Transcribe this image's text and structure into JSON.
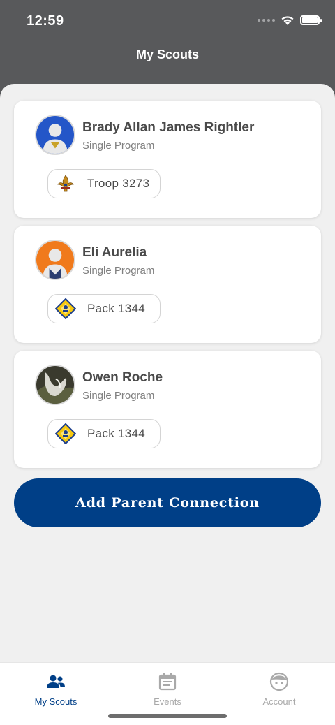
{
  "status_bar": {
    "time": "12:59"
  },
  "header": {
    "title": "My Scouts"
  },
  "scouts": [
    {
      "name": "Brady Allan James Rightler",
      "program": "Single Program",
      "unit": "Troop 3273",
      "unit_emblem": "scouts-bsa-fleur-de-lis-emblem",
      "avatar_color": "#2456c8"
    },
    {
      "name": "Eli  Aurelia",
      "program": "Single Program",
      "unit": "Pack 1344",
      "unit_emblem": "cub-scout-diamond-emblem",
      "avatar_color": "#f07a1c"
    },
    {
      "name": "Owen Roche",
      "program": "Single Program",
      "unit": "Pack 1344",
      "unit_emblem": "cub-scout-diamond-emblem",
      "avatar_color": "#3a3a2e"
    }
  ],
  "actions": {
    "add_parent_connection": "Add Parent Connection"
  },
  "tab_bar": {
    "tabs": [
      {
        "label": "My Scouts",
        "icon": "people-icon",
        "active": true
      },
      {
        "label": "Events",
        "icon": "calendar-icon",
        "active": false
      },
      {
        "label": "Account",
        "icon": "account-face-icon",
        "active": false
      }
    ]
  },
  "colors": {
    "primary": "#003f87",
    "header_bg": "#58595b",
    "content_bg": "#f0f0f0"
  }
}
